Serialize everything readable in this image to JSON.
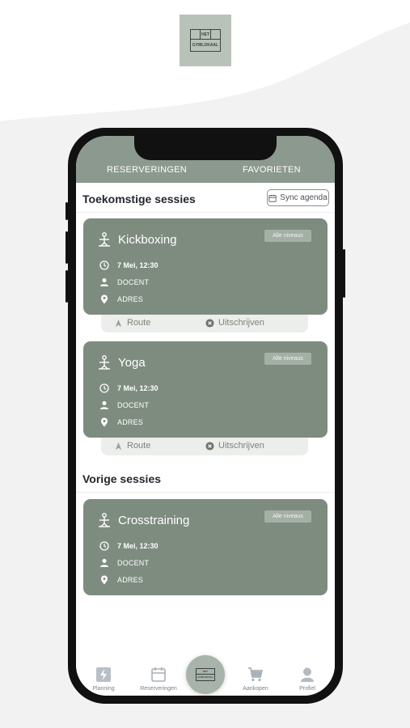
{
  "brand": {
    "logo_top": "HET",
    "logo_bottom": "GYMLOKAAL",
    "accent": "#7e8c80"
  },
  "tabs": [
    {
      "label": "RESERVERINGEN",
      "active": true
    },
    {
      "label": "FAVORIETEN",
      "active": false
    }
  ],
  "upcoming": {
    "title": "Toekomstige sessies",
    "sync_label": "Sync agenda",
    "sessions": [
      {
        "name": "Kickboxing",
        "level": "Alle niveaus",
        "datetime": "7 Mei, 12:30",
        "teacher": "DOCENT",
        "address": "ADRES"
      },
      {
        "name": "Yoga",
        "level": "Alle niveaus",
        "datetime": "7 Mei, 12:30",
        "teacher": "DOCENT",
        "address": "ADRES"
      }
    ],
    "actions": {
      "route": "Route",
      "unsubscribe": "Uitschrijven"
    }
  },
  "previous": {
    "title": "Vorige sessies",
    "sessions": [
      {
        "name": "Crosstraining",
        "level": "Alle niveaus",
        "datetime": "7 Mei, 12:30",
        "teacher": "DOCENT",
        "address": "ADRES"
      }
    ]
  },
  "nav": [
    {
      "label": "Planning",
      "icon": "bolt-icon"
    },
    {
      "label": "Reserveringen",
      "icon": "calendar-icon"
    },
    {
      "label": "",
      "icon": "home-logo"
    },
    {
      "label": "Aankopen",
      "icon": "cart-icon"
    },
    {
      "label": "Profiel",
      "icon": "person-icon"
    }
  ]
}
